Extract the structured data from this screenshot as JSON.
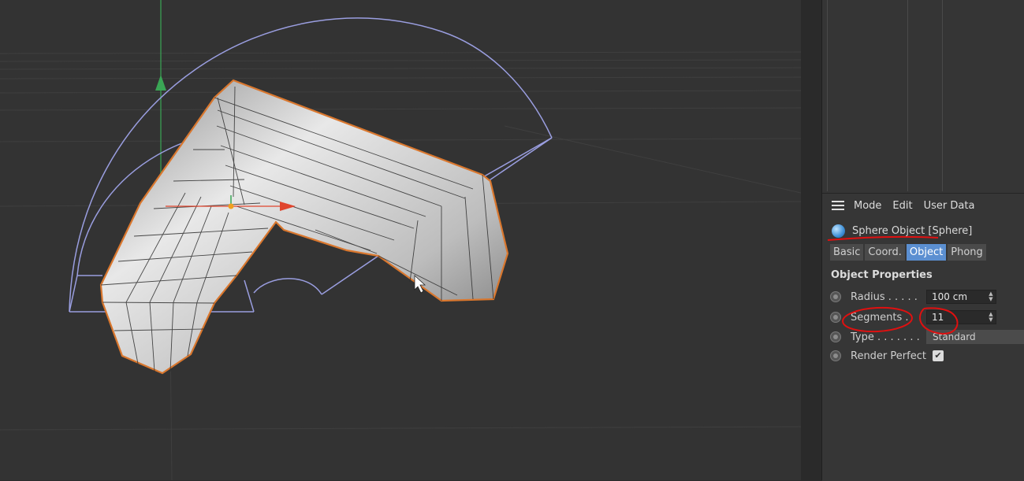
{
  "menu": {
    "items": [
      "Mode",
      "Edit",
      "User Data"
    ]
  },
  "attributes": {
    "object_title": "Sphere Object [Sphere]",
    "tabs": [
      {
        "label": "Basic",
        "active": false
      },
      {
        "label": "Coord.",
        "active": false
      },
      {
        "label": "Object",
        "active": true
      },
      {
        "label": "Phong",
        "active": false
      }
    ],
    "section_title": "Object Properties",
    "radius": {
      "label": "Radius . . . . .",
      "value": "100 cm"
    },
    "segments": {
      "label": "Segments .",
      "value": "11"
    },
    "type": {
      "label": "Type . . . . . . .",
      "value": "Standard"
    },
    "render_perfect": {
      "label": "Render Perfect",
      "checked": true
    }
  },
  "colors": {
    "viewport_bg": "#333333",
    "selection_outline": "#d9772e",
    "deformer_lines": "#9a9ee0",
    "axis_y": "#3aa655",
    "axis_x": "#e0452e",
    "axis_z": "#2e7be0",
    "annotation": "#e01010",
    "active_tab": "#5b8fd1"
  }
}
